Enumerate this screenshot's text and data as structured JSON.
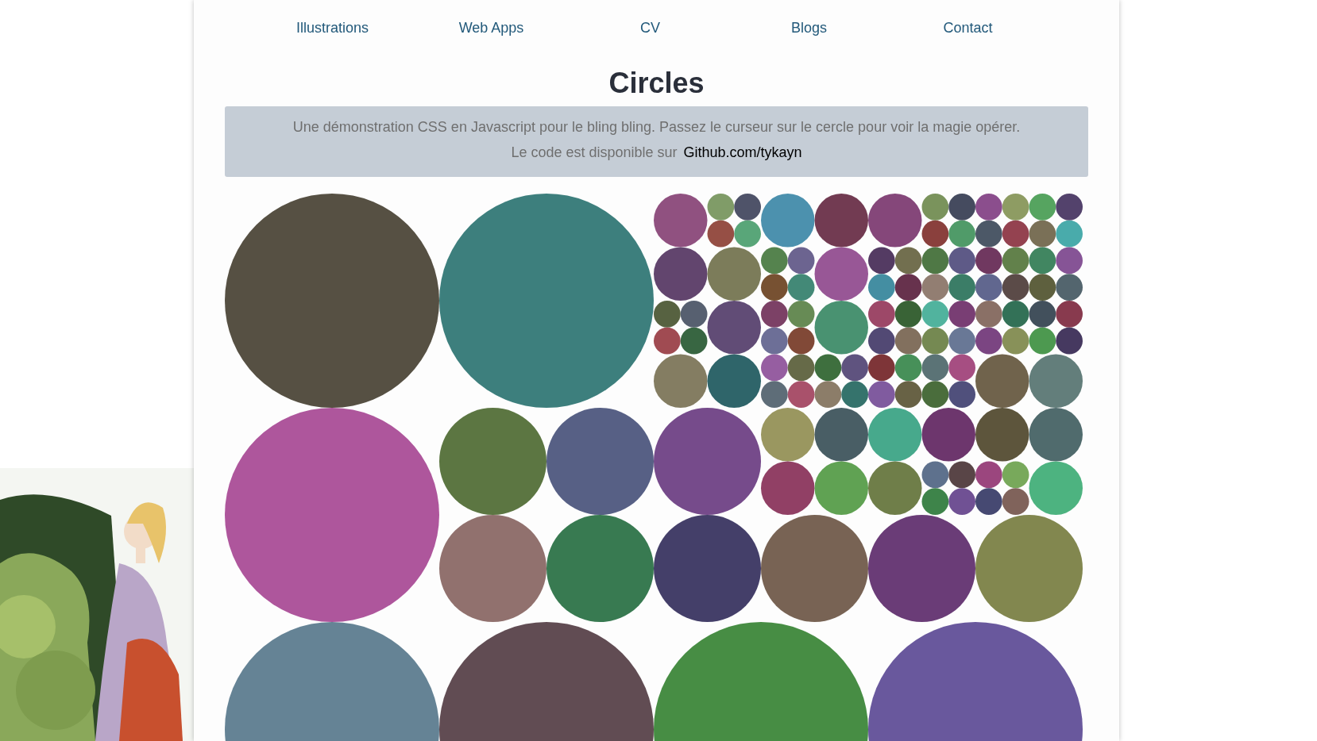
{
  "nav": [
    {
      "label": "Illustrations"
    },
    {
      "label": "Web Apps"
    },
    {
      "label": "CV"
    },
    {
      "label": "Blogs"
    },
    {
      "label": "Contact"
    }
  ],
  "title": "Circles",
  "intro": {
    "line_1": "Une démonstration CSS en Javascript pour le bling bling. Passez le curseur sur le cercle pour voir la magie opérer.",
    "line_2": "Le code est disponible sur",
    "link": "Github.com/tykayn"
  }
}
